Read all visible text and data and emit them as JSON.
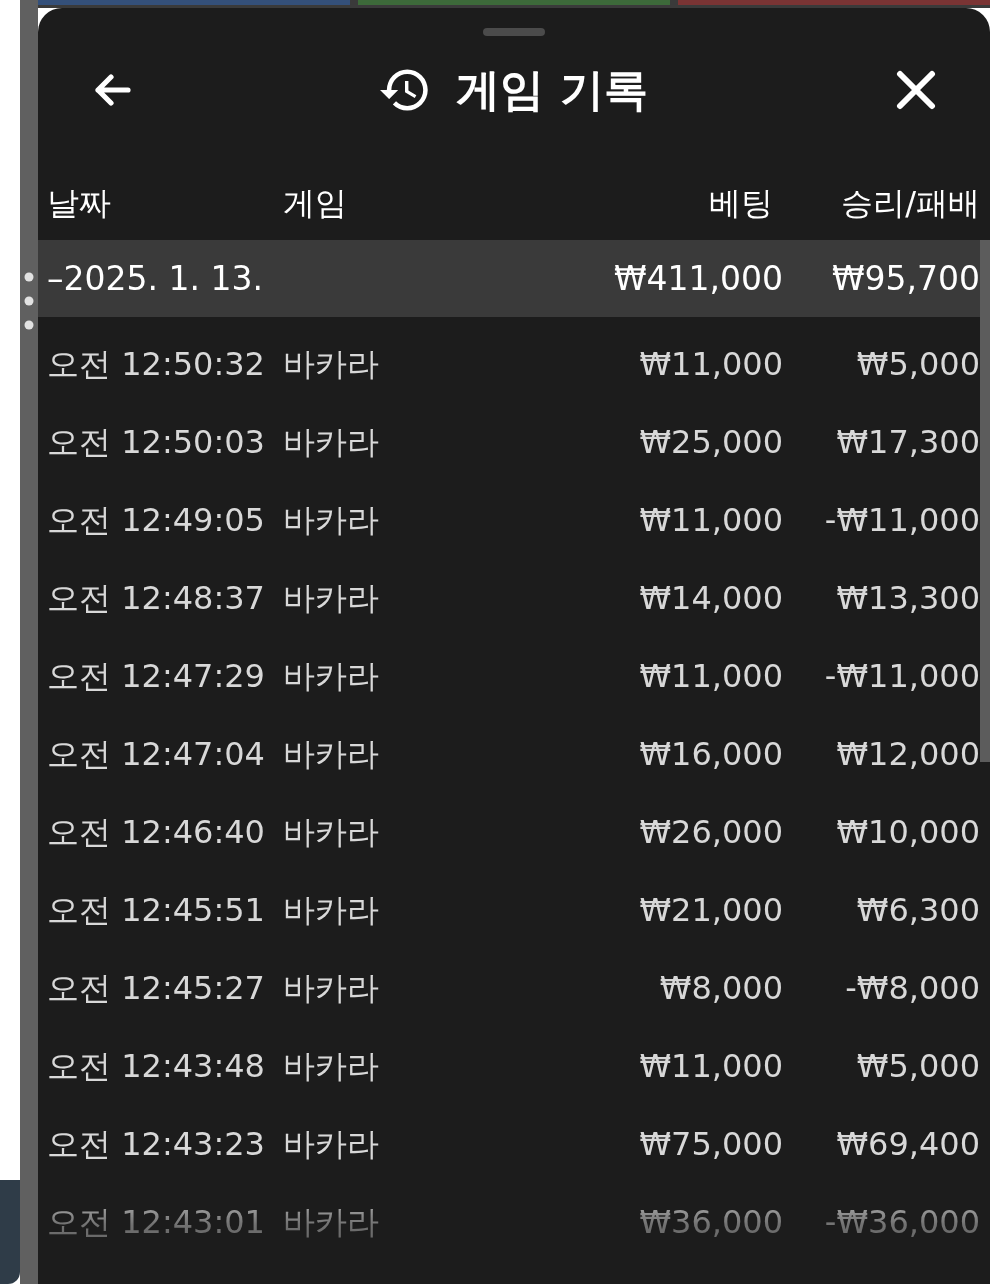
{
  "header": {
    "title": "게임 기록"
  },
  "table": {
    "columns": [
      "날짜",
      "게임",
      "베팅",
      "승리/패배"
    ],
    "date_group": {
      "label": "–2025. 1. 13.",
      "bet": "₩411,000",
      "result": "₩95,700"
    },
    "rows": [
      {
        "time": "오전 12:50:32",
        "game": "바카라",
        "bet": "₩11,000",
        "result": "₩5,000"
      },
      {
        "time": "오전 12:50:03",
        "game": "바카라",
        "bet": "₩25,000",
        "result": "₩17,300"
      },
      {
        "time": "오전 12:49:05",
        "game": "바카라",
        "bet": "₩11,000",
        "result": "-₩11,000"
      },
      {
        "time": "오전 12:48:37",
        "game": "바카라",
        "bet": "₩14,000",
        "result": "₩13,300"
      },
      {
        "time": "오전 12:47:29",
        "game": "바카라",
        "bet": "₩11,000",
        "result": "-₩11,000"
      },
      {
        "time": "오전 12:47:04",
        "game": "바카라",
        "bet": "₩16,000",
        "result": "₩12,000"
      },
      {
        "time": "오전 12:46:40",
        "game": "바카라",
        "bet": "₩26,000",
        "result": "₩10,000"
      },
      {
        "time": "오전 12:45:51",
        "game": "바카라",
        "bet": "₩21,000",
        "result": "₩6,300"
      },
      {
        "time": "오전 12:45:27",
        "game": "바카라",
        "bet": "₩8,000",
        "result": "-₩8,000"
      },
      {
        "time": "오전 12:43:48",
        "game": "바카라",
        "bet": "₩11,000",
        "result": "₩5,000"
      },
      {
        "time": "오전 12:43:23",
        "game": "바카라",
        "bet": "₩75,000",
        "result": "₩69,400"
      },
      {
        "time": "오전 12:43:01",
        "game": "바카라",
        "bet": "₩36,000",
        "result": "-₩36,000"
      }
    ]
  }
}
